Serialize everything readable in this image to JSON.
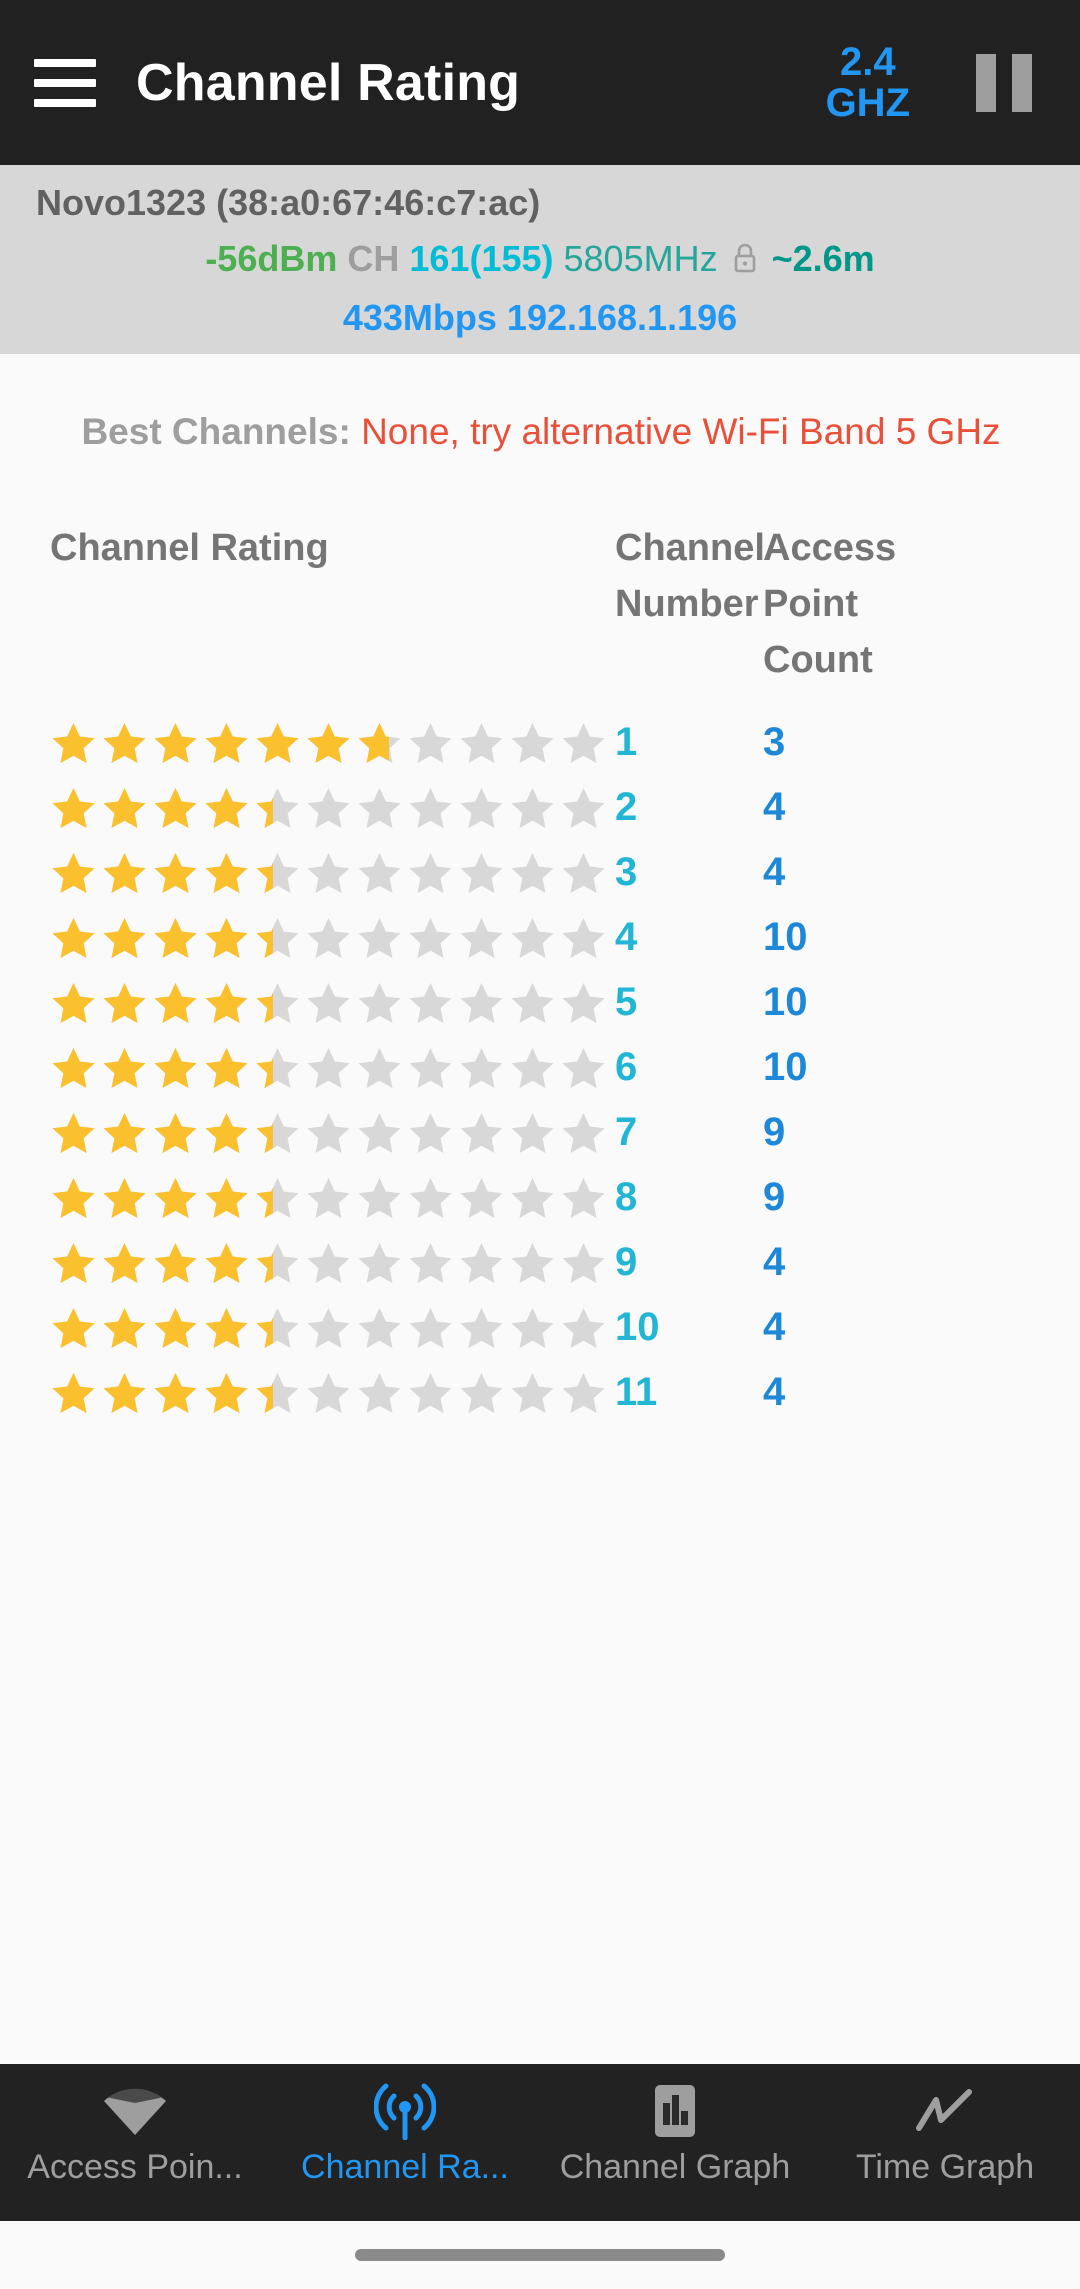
{
  "header": {
    "menu_icon": "hamburger-menu-icon",
    "title": "Channel Rating",
    "band_label": "2.4\nGHZ",
    "pause_icon": "pause-icon"
  },
  "connected_ap": {
    "ssid_line": "Novo1323 (38:a0:67:46:c7:ac)",
    "signal": "-56dBm",
    "ch_label": "CH",
    "channel": "161(155)",
    "frequency": "5805MHz",
    "lock_icon": "lock-icon",
    "distance": "~2.6m",
    "link_speed": "433Mbps",
    "ip_address": "192.168.1.196"
  },
  "best_channels": {
    "label": "Best Channels:",
    "value": "None, try alternative Wi-Fi Band 5 GHz"
  },
  "table": {
    "headers": {
      "rating": "Channel Rating",
      "channel_number": "Channel Number",
      "access_point_count": "Access Point Count"
    },
    "max_stars": 11,
    "rows": [
      {
        "rating": 6.7,
        "channel": "1",
        "ap_count": "3"
      },
      {
        "rating": 4.4,
        "channel": "2",
        "ap_count": "4"
      },
      {
        "rating": 4.4,
        "channel": "3",
        "ap_count": "4"
      },
      {
        "rating": 4.4,
        "channel": "4",
        "ap_count": "10"
      },
      {
        "rating": 4.4,
        "channel": "5",
        "ap_count": "10"
      },
      {
        "rating": 4.4,
        "channel": "6",
        "ap_count": "10"
      },
      {
        "rating": 4.4,
        "channel": "7",
        "ap_count": "9"
      },
      {
        "rating": 4.4,
        "channel": "8",
        "ap_count": "9"
      },
      {
        "rating": 4.4,
        "channel": "9",
        "ap_count": "4"
      },
      {
        "rating": 4.4,
        "channel": "10",
        "ap_count": "4"
      },
      {
        "rating": 4.4,
        "channel": "11",
        "ap_count": "4"
      }
    ]
  },
  "bottom_nav": {
    "items": [
      {
        "label": "Access Poin...",
        "icon": "wifi-icon",
        "active": false
      },
      {
        "label": "Channel Ra...",
        "icon": "radio-antenna-icon",
        "active": true
      },
      {
        "label": "Channel Graph",
        "icon": "bar-chart-icon",
        "active": false
      },
      {
        "label": "Time Graph",
        "icon": "line-chart-icon",
        "active": false
      }
    ]
  },
  "colors": {
    "accent_blue": "#2196f3",
    "star_filled": "#fbc02d",
    "star_empty": "#d8d8d8",
    "channel_cyan": "#23b6d4",
    "apcount_blue": "#1e88d8",
    "warning_red": "#e8503a",
    "appbar_bg": "#212121",
    "infobar_bg": "#d7d7d7"
  }
}
